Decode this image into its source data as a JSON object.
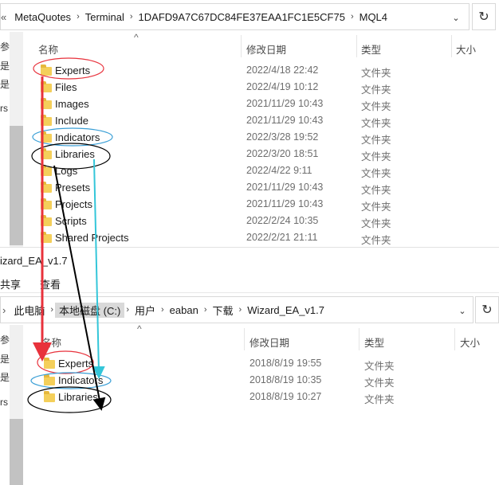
{
  "top_window": {
    "breadcrumb_lead": "«",
    "breadcrumb": [
      "MetaQuotes",
      "Terminal",
      "1DAFD9A7C67DC84FE37EAA1FC1E5CF75",
      "MQL4"
    ],
    "dropdown_icon": "chevron-down-icon",
    "refresh_icon": "refresh-icon",
    "sort_arrow": "^",
    "columns": {
      "name": "名称",
      "date": "修改日期",
      "type": "类型",
      "size": "大小"
    },
    "left_pane_items": [
      "参考",
      "是",
      "是",
      "rs"
    ],
    "files": [
      {
        "name": "Experts",
        "date": "2022/4/18 22:42",
        "type": "文件夹"
      },
      {
        "name": "Files",
        "date": "2022/4/19 10:12",
        "type": "文件夹"
      },
      {
        "name": "Images",
        "date": "2021/11/29 10:43",
        "type": "文件夹"
      },
      {
        "name": "Include",
        "date": "2021/11/29 10:43",
        "type": "文件夹"
      },
      {
        "name": "Indicators",
        "date": "2022/3/28 19:52",
        "type": "文件夹"
      },
      {
        "name": "Libraries",
        "date": "2022/3/20 18:51",
        "type": "文件夹"
      },
      {
        "name": "Logs",
        "date": "2022/4/22 9:11",
        "type": "文件夹"
      },
      {
        "name": "Presets",
        "date": "2021/11/29 10:43",
        "type": "文件夹"
      },
      {
        "name": "Projects",
        "date": "2021/11/29 10:43",
        "type": "文件夹"
      },
      {
        "name": "Scripts",
        "date": "2022/2/24 10:35",
        "type": "文件夹"
      },
      {
        "name": "Shared Projects",
        "date": "2022/2/21 21:11",
        "type": "文件夹"
      }
    ]
  },
  "bottom_window": {
    "title": "izard_EA_v1.7",
    "ribbon": [
      "共享",
      "查看"
    ],
    "breadcrumb_lead": "›",
    "breadcrumb": [
      "此电脑",
      "本地磁盘 (C:)",
      "用户",
      "eaban",
      "下载",
      "Wizard_EA_v1.7"
    ],
    "highlighted_crumb": "本地磁盘 (C:)",
    "dropdown_icon": "chevron-down-icon",
    "refresh_icon": "refresh-icon",
    "sort_arrow": "^",
    "columns": {
      "name": "名称",
      "date": "修改日期",
      "type": "类型",
      "size": "大小"
    },
    "left_pane_items": [
      "参考",
      "是",
      "是",
      "rs"
    ],
    "files": [
      {
        "name": "Experts",
        "date": "2018/8/19 19:55",
        "type": "文件夹"
      },
      {
        "name": "Indicators",
        "date": "2018/8/19 10:35",
        "type": "文件夹"
      },
      {
        "name": "Libraries",
        "date": "2018/8/19 10:27",
        "type": "文件夹"
      }
    ]
  },
  "annotations": {
    "experts_color": "#e8323c",
    "indicators_color": "#3a9fd6",
    "libraries_color": "#000000",
    "indicators_arrow_color": "#34c6d9"
  }
}
